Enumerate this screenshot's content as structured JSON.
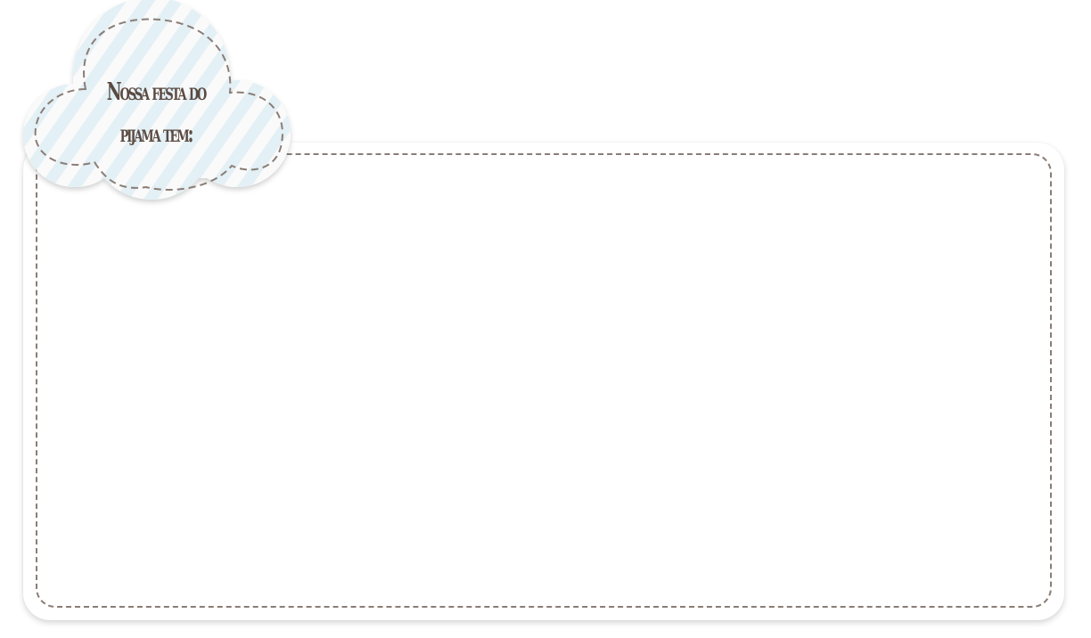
{
  "badge": {
    "line1": "Nossa festa do",
    "line2": "pijama tem:"
  },
  "colors": {
    "stitch": "#8a7d76",
    "text": "#5a4a42",
    "stripe_blue": "#e3f0f5",
    "stripe_white": "#fafafa"
  }
}
